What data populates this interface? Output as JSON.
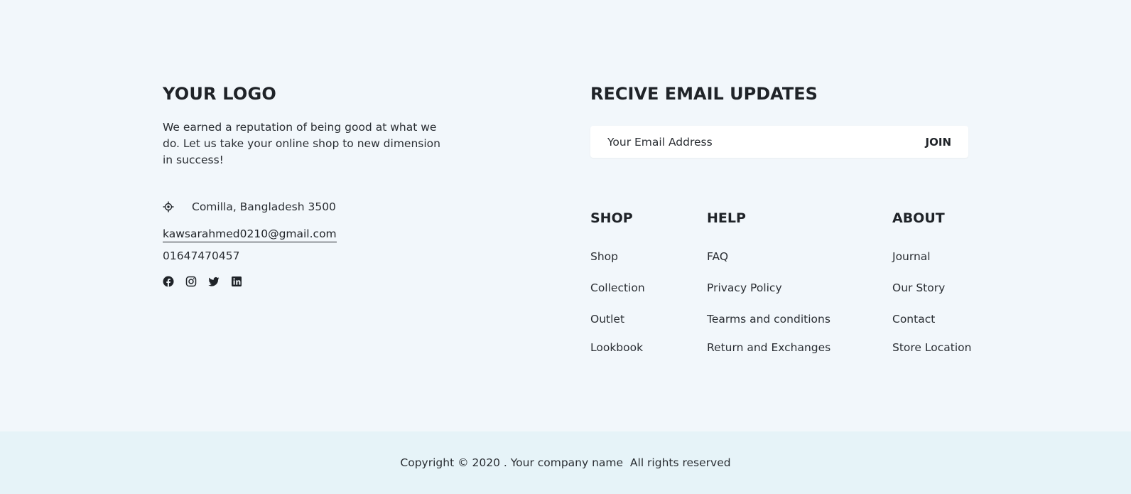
{
  "brand": {
    "logo": "YOUR LOGO",
    "tagline": "We earned a reputation of being good at what we do. Let us take your online shop to new dimension in success!"
  },
  "contact": {
    "address": "Comilla, Bangladesh 3500",
    "address_icon": "location-icon",
    "email": "kawsarahmed0210@gmail.com",
    "phone": "01647470457"
  },
  "socials": [
    "facebook-icon",
    "instagram-icon",
    "twitter-icon",
    "linkedin-icon"
  ],
  "newsletter": {
    "title": "RECIVE EMAIL UPDATES",
    "placeholder": "Your Email Address",
    "button_label": "JOIN"
  },
  "columns": {
    "shop": {
      "title": "SHOP",
      "links": [
        "Shop",
        "Collection",
        "Outlet",
        "Lookbook"
      ]
    },
    "help": {
      "title": "HELP",
      "links": [
        "FAQ",
        "Privacy Policy",
        "Tearms and conditions",
        "Return and Exchanges"
      ]
    },
    "about": {
      "title": "ABOUT",
      "links": [
        "Journal",
        "Our Story",
        "Contact",
        "Store Location"
      ]
    }
  },
  "copyright": "Copyright © 2020 . Your company name  All rights reserved",
  "colors": {
    "page_bg": "#f2f7fb",
    "bottom_bar_bg": "#e6f3f8",
    "text": "#1f2328"
  }
}
